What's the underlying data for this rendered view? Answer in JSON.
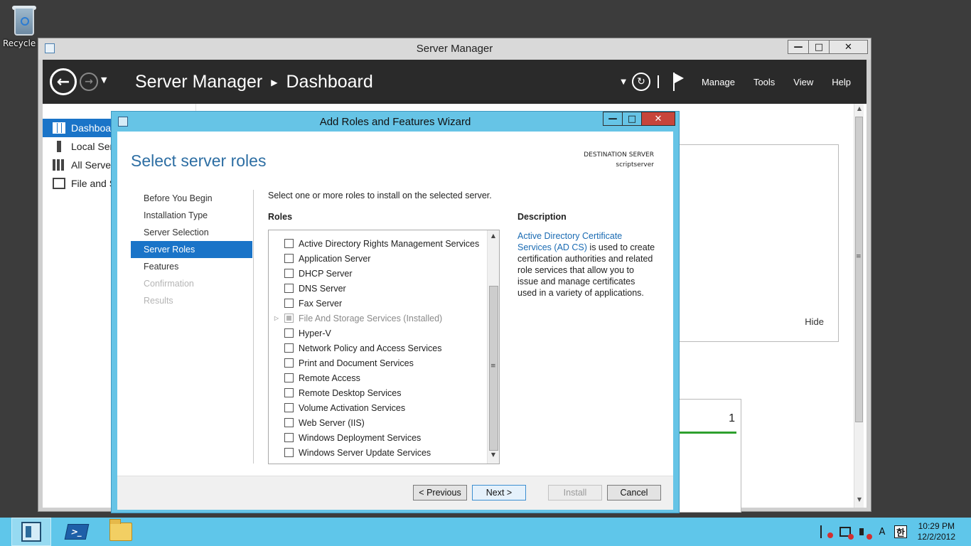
{
  "desktop": {
    "recycle_bin_label": "Recycle Bin"
  },
  "server_manager": {
    "window_title": "Server Manager",
    "breadcrumb": {
      "root": "Server Manager",
      "current": "Dashboard"
    },
    "menus": [
      "Manage",
      "Tools",
      "View",
      "Help"
    ],
    "sidebar": [
      {
        "label": "Dashboard",
        "icon": "dashboard-icon",
        "active": true
      },
      {
        "label": "Local Server",
        "icon": "local-server-icon"
      },
      {
        "label": "All Servers",
        "icon": "all-servers-icon"
      },
      {
        "label": "File and Storage Services",
        "icon": "file-storage-icon"
      }
    ],
    "welcome_hide": "Hide",
    "tile_count": "1"
  },
  "wizard": {
    "title": "Add Roles and Features Wizard",
    "heading": "Select server roles",
    "destination_label": "DESTINATION SERVER",
    "destination_value": "scriptserver",
    "nav": [
      {
        "label": "Before You Begin",
        "state": "normal"
      },
      {
        "label": "Installation Type",
        "state": "normal"
      },
      {
        "label": "Server Selection",
        "state": "normal"
      },
      {
        "label": "Server Roles",
        "state": "active"
      },
      {
        "label": "Features",
        "state": "normal"
      },
      {
        "label": "Confirmation",
        "state": "disabled"
      },
      {
        "label": "Results",
        "state": "disabled"
      }
    ],
    "instruction": "Select one or more roles to install on the selected server.",
    "roles_header": "Roles",
    "roles": [
      {
        "label": "Active Directory Rights Management Services",
        "checked": false
      },
      {
        "label": "Application Server",
        "checked": false
      },
      {
        "label": "DHCP Server",
        "checked": false
      },
      {
        "label": "DNS Server",
        "checked": false
      },
      {
        "label": "Fax Server",
        "checked": false
      },
      {
        "label": "File And Storage Services (Installed)",
        "checked": true,
        "installed": true,
        "expandable": true
      },
      {
        "label": "Hyper-V",
        "checked": false
      },
      {
        "label": "Network Policy and Access Services",
        "checked": false
      },
      {
        "label": "Print and Document Services",
        "checked": false
      },
      {
        "label": "Remote Access",
        "checked": false
      },
      {
        "label": "Remote Desktop Services",
        "checked": false
      },
      {
        "label": "Volume Activation Services",
        "checked": false
      },
      {
        "label": "Web Server (IIS)",
        "checked": false
      },
      {
        "label": "Windows Deployment Services",
        "checked": false
      },
      {
        "label": "Windows Server Update Services",
        "checked": false
      }
    ],
    "description_header": "Description",
    "description_link": "Active Directory Certificate Services (AD CS)",
    "description_body": " is used to create certification authorities and related role services that allow you to issue and manage certificates used in a variety of applications.",
    "buttons": {
      "previous": "< Previous",
      "next": "Next >",
      "install": "Install",
      "cancel": "Cancel"
    }
  },
  "taskbar": {
    "clock_time": "10:29 PM",
    "clock_date": "12/2/2012",
    "ime_a": "A",
    "ime_han": "한"
  }
}
